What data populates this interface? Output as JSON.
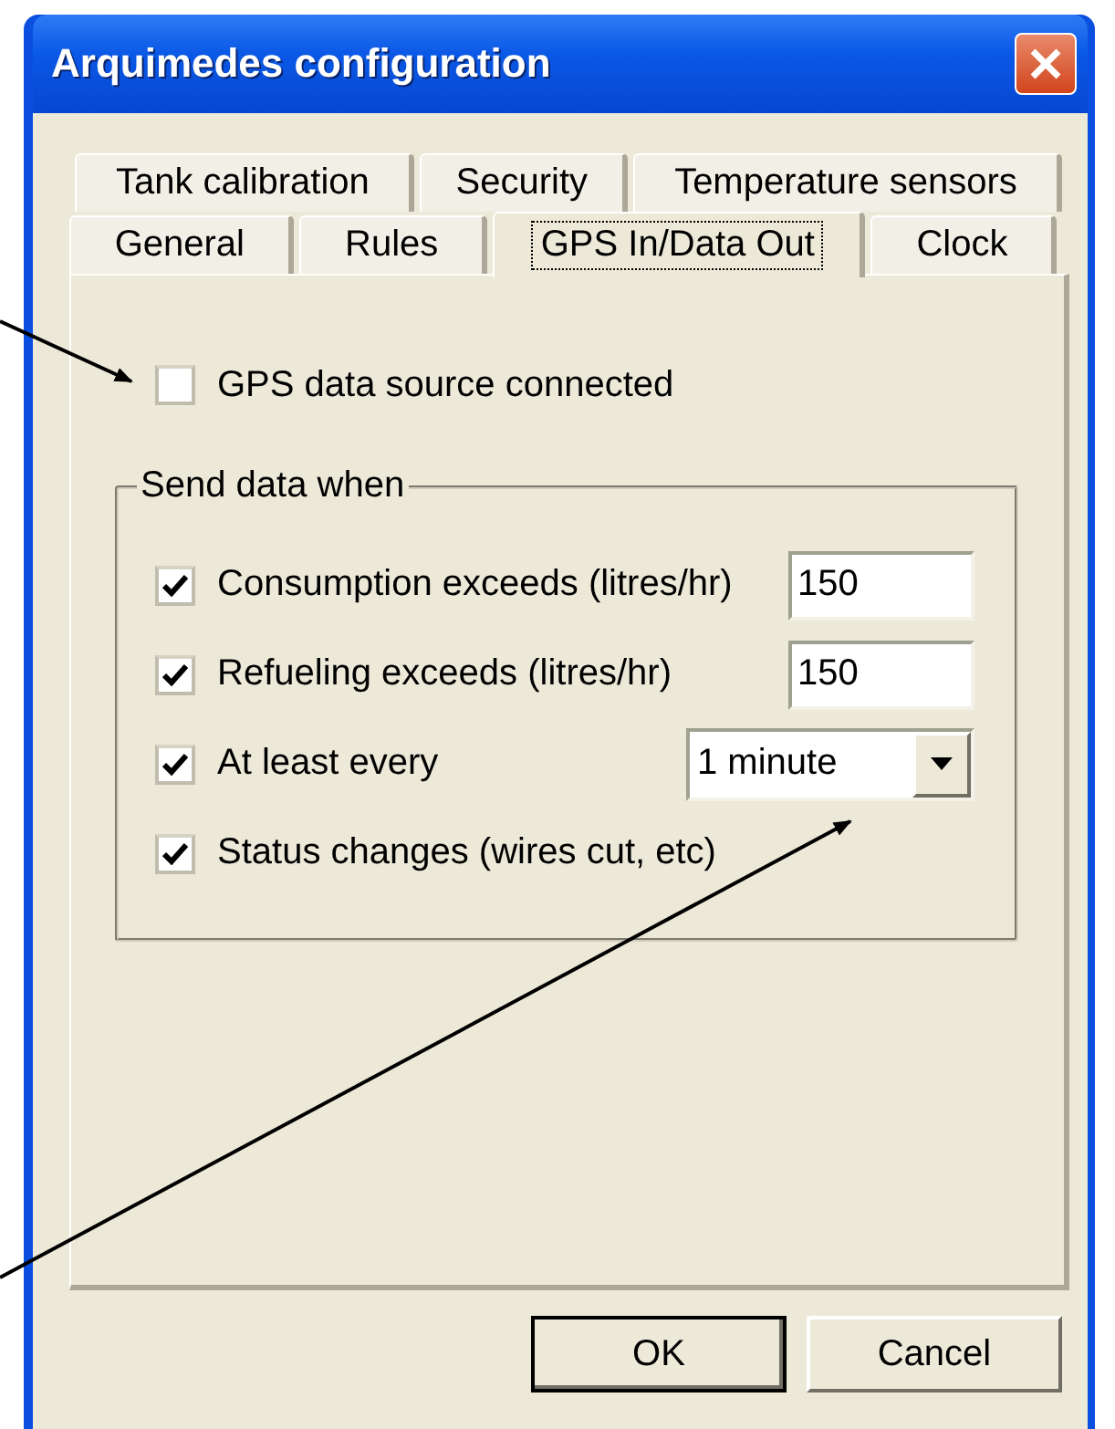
{
  "window": {
    "title": "Arquimedes configuration"
  },
  "tab_rows": [
    [
      {
        "label": "Tank calibration",
        "selected": false
      },
      {
        "label": "Security",
        "selected": false
      },
      {
        "label": "Temperature sensors",
        "selected": false
      }
    ],
    [
      {
        "label": "General",
        "selected": false
      },
      {
        "label": "Rules",
        "selected": false
      },
      {
        "label": "GPS In/Data Out",
        "selected": true
      },
      {
        "label": "Clock",
        "selected": false
      }
    ]
  ],
  "gps_source": {
    "label": "GPS data source connected",
    "checked": false
  },
  "send_group": {
    "title": "Send data when",
    "rows": [
      {
        "kind": "field",
        "label": "Consumption exceeds (litres/hr)",
        "checked": true,
        "value": "150"
      },
      {
        "kind": "field",
        "label": "Refueling exceeds (litres/hr)",
        "checked": true,
        "value": "150"
      },
      {
        "kind": "dropdown",
        "label": "At least every",
        "checked": true,
        "value": "1 minute"
      },
      {
        "kind": "plain",
        "label": "Status changes (wires cut, etc)",
        "checked": true
      }
    ]
  },
  "buttons": [
    {
      "label": "OK",
      "default": true
    },
    {
      "label": "Cancel",
      "default": false
    }
  ]
}
